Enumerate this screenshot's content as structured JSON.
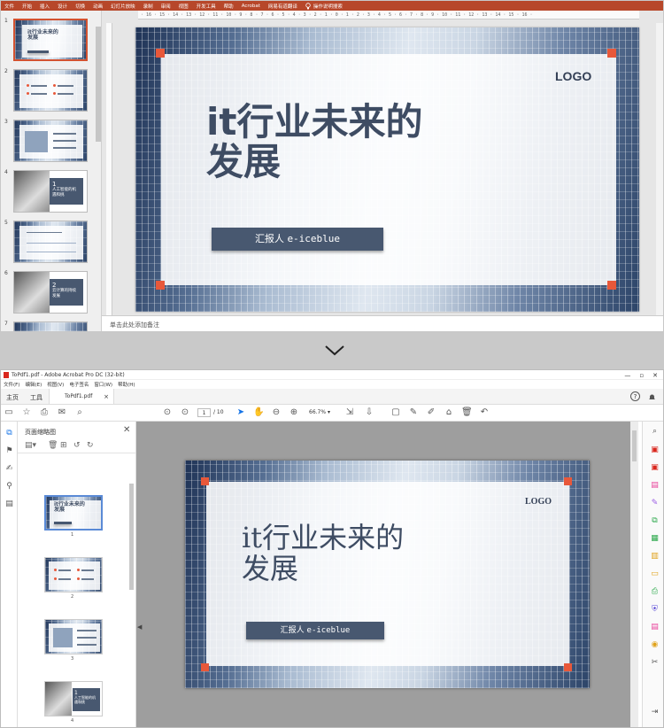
{
  "ppt": {
    "menu": [
      "文件",
      "开始",
      "插入",
      "设计",
      "切换",
      "动画",
      "幻灯片放映",
      "录制",
      "审阅",
      "视图",
      "开发工具",
      "帮助",
      "Acrobat",
      "网易有道翻译"
    ],
    "tell_me": "操作说明搜索",
    "ruler_text": "· 16 · 15 · 14 · 13 · 12 · 11 · 10 · 9 · 8 · 7 · 6 · 5 · 4 · 3 · 2 · 1 · 0 · 1 · 2 · 3 · 4 · 5 · 6 · 7 · 8 · 9 · 10 · 11 · 12 · 13 · 14 · 15 · 16 ·",
    "slide_numbers": [
      "1",
      "2",
      "3",
      "4",
      "5",
      "6",
      "7"
    ],
    "thumb_texts": {
      "t1_title": "it行业未来的\n发展",
      "t4_num": "1",
      "t4_text": "人工智能的机\n遇和挑",
      "t6_num": "2",
      "t6_text": "云计算的持续\n发展"
    },
    "notes_placeholder": "单击此处添加备注"
  },
  "slide": {
    "title": "it行业未来的\n发展",
    "logo": "LOGO",
    "presenter_label": "汇报人",
    "presenter_name": "e-iceblue"
  },
  "acrobat": {
    "window_title": "ToPdf1.pdf - Adobe Acrobat Pro DC (32-bit)",
    "menu": [
      "文件(F)",
      "编辑(E)",
      "视图(V)",
      "电子签名",
      "窗口(W)",
      "帮助(H)"
    ],
    "tabs": {
      "home": "主页",
      "tools": "工具",
      "doc": "ToPdf1.pdf",
      "doc_close": "×"
    },
    "toolbar": {
      "page_current": "1",
      "page_total": "/ 10",
      "zoom": "66.7%"
    },
    "panel_title": "页面缩略图",
    "thumb_labels": [
      "1",
      "2",
      "3",
      "4"
    ],
    "pdf_thumb4_text": "人工智能的机\n遇和挑"
  },
  "colors": {
    "ppt_accent": "#b7472a",
    "corner_orange": "#e8583a",
    "slide_text": "#3e4c63",
    "acrobat_blue": "#1473e6"
  }
}
